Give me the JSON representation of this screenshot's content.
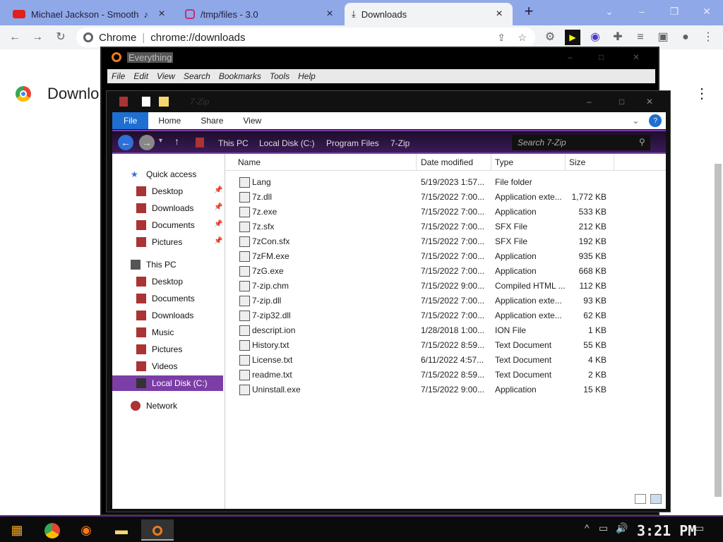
{
  "tabs": [
    {
      "title": "Michael Jackson - Smooth",
      "icon": "youtube-icon",
      "audio": "♪"
    },
    {
      "title": "/tmp/files - 3.0",
      "icon": "folder-icon"
    },
    {
      "title": "Downloads",
      "icon": "download-icon"
    }
  ],
  "toolbar": {
    "site": "Chrome",
    "url": "chrome://downloads"
  },
  "chrome_page": {
    "title": "Downlo"
  },
  "everything": {
    "title": "Everything",
    "menu": [
      "File",
      "Edit",
      "View",
      "Search",
      "Bookmarks",
      "Tools",
      "Help"
    ]
  },
  "explorer": {
    "title": "7-Zip",
    "ribbon": [
      "File",
      "Home",
      "Share",
      "View"
    ],
    "breadcrumb": [
      "This PC",
      "Local Disk (C:)",
      "Program Files",
      "7-Zip"
    ],
    "search_placeholder": "Search 7-Zip",
    "nav": {
      "quick_access": "Quick access",
      "quick": [
        "Desktop",
        "Downloads",
        "Documents",
        "Pictures"
      ],
      "this_pc": "This PC",
      "pc": [
        "Desktop",
        "Documents",
        "Downloads",
        "Music",
        "Pictures",
        "Videos",
        "Local Disk (C:)"
      ],
      "network": "Network"
    },
    "columns": {
      "name": "Name",
      "date": "Date modified",
      "type": "Type",
      "size": "Size"
    },
    "files": [
      {
        "name": "Lang",
        "date": "5/19/2023 1:57...",
        "type": "File folder",
        "size": ""
      },
      {
        "name": "7z.dll",
        "date": "7/15/2022 7:00...",
        "type": "Application exte...",
        "size": "1,772 KB"
      },
      {
        "name": "7z.exe",
        "date": "7/15/2022 7:00...",
        "type": "Application",
        "size": "533 KB"
      },
      {
        "name": "7z.sfx",
        "date": "7/15/2022 7:00...",
        "type": "SFX File",
        "size": "212 KB"
      },
      {
        "name": "7zCon.sfx",
        "date": "7/15/2022 7:00...",
        "type": "SFX File",
        "size": "192 KB"
      },
      {
        "name": "7zFM.exe",
        "date": "7/15/2022 7:00...",
        "type": "Application",
        "size": "935 KB"
      },
      {
        "name": "7zG.exe",
        "date": "7/15/2022 7:00...",
        "type": "Application",
        "size": "668 KB"
      },
      {
        "name": "7-zip.chm",
        "date": "7/15/2022 9:00...",
        "type": "Compiled HTML ...",
        "size": "112 KB"
      },
      {
        "name": "7-zip.dll",
        "date": "7/15/2022 7:00...",
        "type": "Application exte...",
        "size": "93 KB"
      },
      {
        "name": "7-zip32.dll",
        "date": "7/15/2022 7:00...",
        "type": "Application exte...",
        "size": "62 KB"
      },
      {
        "name": "descript.ion",
        "date": "1/28/2018 1:00...",
        "type": "ION File",
        "size": "1 KB"
      },
      {
        "name": "History.txt",
        "date": "7/15/2022 8:59...",
        "type": "Text Document",
        "size": "55 KB"
      },
      {
        "name": "License.txt",
        "date": "6/11/2022 4:57...",
        "type": "Text Document",
        "size": "4 KB"
      },
      {
        "name": "readme.txt",
        "date": "7/15/2022 8:59...",
        "type": "Text Document",
        "size": "2 KB"
      },
      {
        "name": "Uninstall.exe",
        "date": "7/15/2022 9:00...",
        "type": "Application",
        "size": "15 KB"
      }
    ]
  },
  "taskbar": {
    "clock": "3:21 PM"
  },
  "colors": {
    "tab_strip": "#8fa8e8",
    "accent": "#1e6fd1",
    "purple": "#7b3ea6"
  }
}
